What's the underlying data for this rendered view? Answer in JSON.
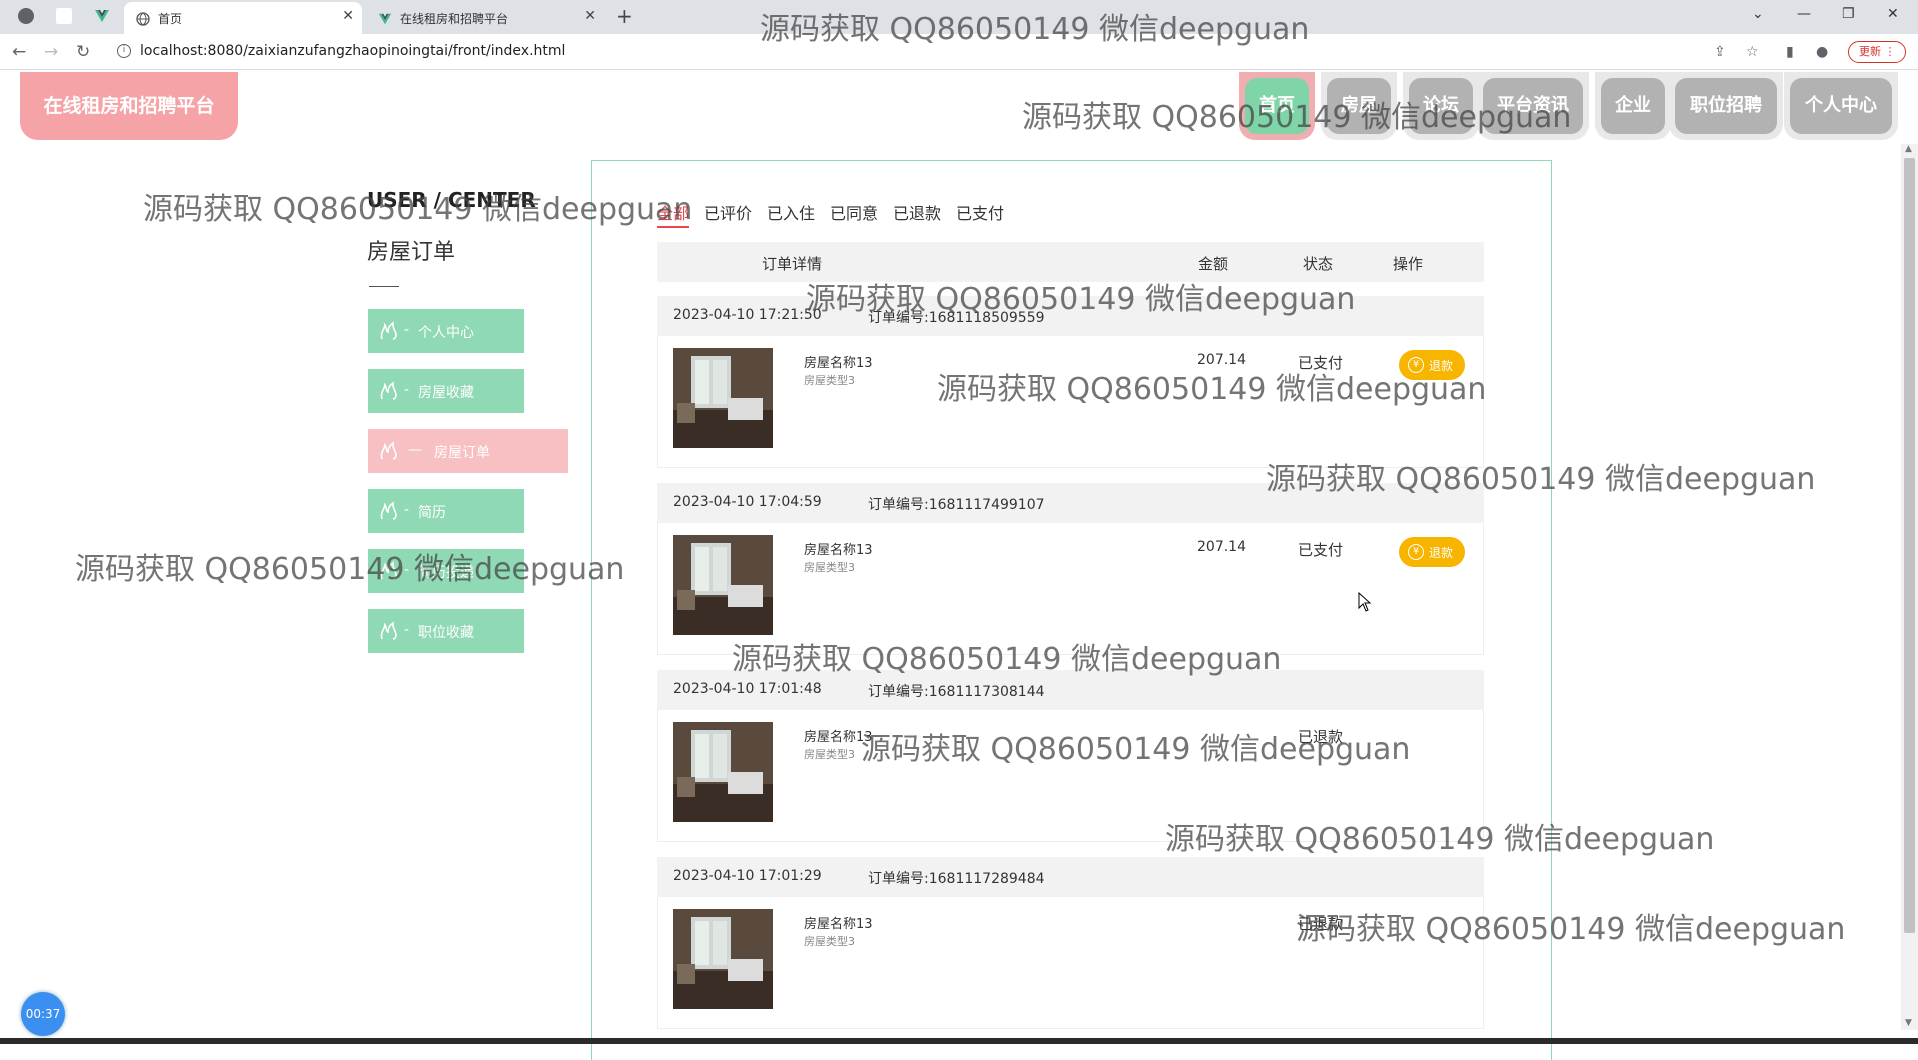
{
  "browser": {
    "tabs": [
      {
        "label": "首页",
        "active": true
      },
      {
        "label": "在线租房和招聘平台",
        "active": false
      }
    ],
    "new_tab": "+",
    "url": "localhost:8080/zaixianzufangzhaopinoingtai/front/index.html",
    "update_label": "更新"
  },
  "site": {
    "logo": "在线租房和招聘平台",
    "nav": [
      "首页",
      "房屋",
      "论坛",
      "平台资讯",
      "企业",
      "职位招聘",
      "个人中心"
    ]
  },
  "sidebar": {
    "title_en": "USER / CENTER",
    "title_cn": "房屋订单",
    "items": [
      {
        "label": "个人中心",
        "active": false
      },
      {
        "label": "房屋收藏",
        "active": false
      },
      {
        "label": "房屋订单",
        "active": true
      },
      {
        "label": "简历",
        "active": false
      },
      {
        "label": "简历投递",
        "active": false
      },
      {
        "label": "职位收藏",
        "active": false
      }
    ]
  },
  "orders_page": {
    "filters": [
      "全部",
      "已评价",
      "已入住",
      "已同意",
      "已退款",
      "已支付"
    ],
    "active_filter": "全部",
    "columns": [
      "订单详情",
      "金额",
      "状态",
      "操作"
    ],
    "orders": [
      {
        "time": "2023-04-10 17:21:50",
        "order_no": "订单编号:1681118509559",
        "name": "房屋名称13",
        "type": "房屋类型3",
        "amount": "207.14",
        "status": "已支付",
        "action": "退款"
      },
      {
        "time": "2023-04-10 17:04:59",
        "order_no": "订单编号:1681117499107",
        "name": "房屋名称13",
        "type": "房屋类型3",
        "amount": "207.14",
        "status": "已支付",
        "action": "退款"
      },
      {
        "time": "2023-04-10 17:01:48",
        "order_no": "订单编号:1681117308144",
        "name": "房屋名称13",
        "type": "房屋类型3",
        "amount": "",
        "status": "已退款",
        "action": ""
      },
      {
        "time": "2023-04-10 17:01:29",
        "order_no": "订单编号:1681117289484",
        "name": "房屋名称13",
        "type": "房屋类型3",
        "amount": "",
        "status": "已退款",
        "action": ""
      }
    ]
  },
  "timer": "00:37",
  "watermark": "源码获取 QQ86050149 微信deepguan",
  "colors": {
    "accent_green": "#8fd9b4",
    "accent_pink": "#f5a3a6",
    "active_filter": "#e8474d",
    "refund_button": "#f7b500"
  }
}
